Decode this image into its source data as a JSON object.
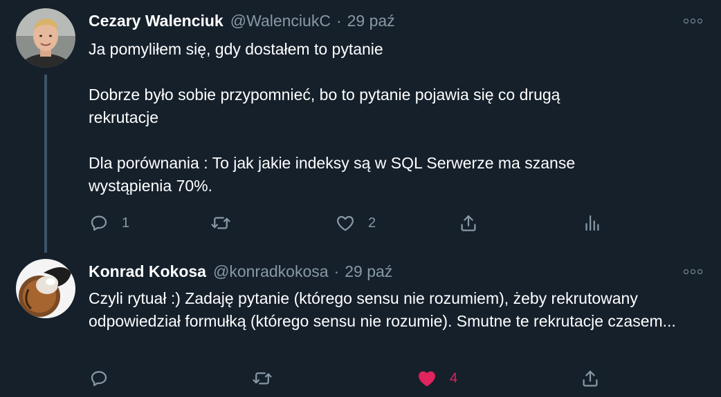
{
  "tweets": [
    {
      "author_name": "Cezary Walenciuk",
      "handle": "@WalenciukC",
      "separator": "·",
      "time": "29 paź",
      "paragraphs": [
        "Ja pomyliłem się, gdy dostałem to pytanie",
        "Dobrze było sobie przypomnieć, bo to pytanie pojawia się co drugą rekrutacje",
        "Dla porównania : To jak jakie indeksy są w SQL Serwerze ma szanse wystąpienia 70%."
      ],
      "actions": {
        "reply_count": "1",
        "retweet_count": "",
        "like_count": "2",
        "liked": false,
        "has_analytics": true
      }
    },
    {
      "author_name": "Konrad Kokosa",
      "handle": "@konradkokosa",
      "separator": "·",
      "time": "29 paź",
      "paragraphs": [
        "Czyli rytuał :) Zadaję pytanie (którego sensu nie rozumiem), żeby rekrutowany odpowiedział formułką (którego sensu nie rozumie). Smutne te rekrutacje czasem..."
      ],
      "actions": {
        "reply_count": "",
        "retweet_count": "",
        "like_count": "4",
        "liked": true,
        "has_analytics": false
      }
    }
  ],
  "colors": {
    "background": "#15202b",
    "text_primary": "#ffffff",
    "text_secondary": "#8899a6",
    "like_active": "#e0245e",
    "thread_line": "#3d5466"
  },
  "icons": [
    "avatar-photo",
    "more-options-icon",
    "reply-icon",
    "retweet-icon",
    "like-icon",
    "share-icon",
    "analytics-icon"
  ]
}
